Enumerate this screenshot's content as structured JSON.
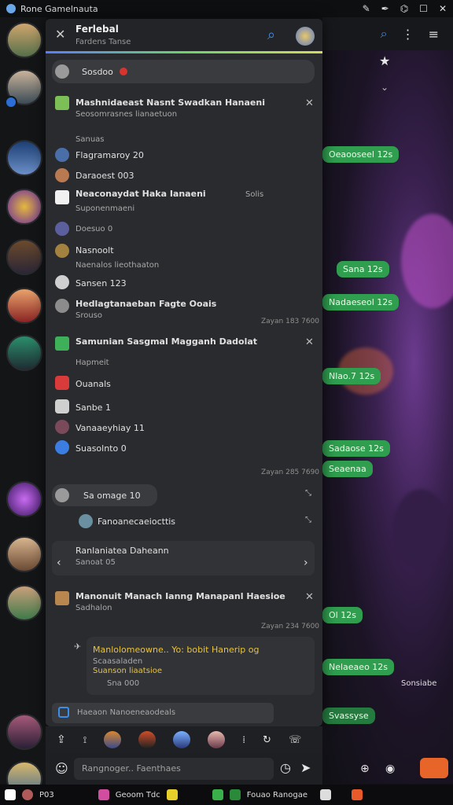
{
  "statusbar": {
    "title": "Rone Gamelnauta"
  },
  "panel": {
    "header": {
      "title": "Ferlebal",
      "subtitle": "Fardens Tanse"
    },
    "search": {
      "label": "Sosdoo"
    },
    "items": [
      {
        "title": "Mashnidaeast Nasnt Swadkan Hanaeni",
        "sub": "Seosomrasnes lianaetuon"
      },
      {
        "label": "Sanuas"
      },
      {
        "label": "Flagramaroy 20"
      },
      {
        "label": "Daraoest 003"
      },
      {
        "title": "Neaconaydat Haka Ianaeni",
        "extra": "Solis",
        "sub": "Suponenmaeni"
      },
      {
        "label": "Doesuo 0"
      },
      {
        "label": "Nasnoolt"
      },
      {
        "sub": "Naenalos lieothaaton"
      },
      {
        "label": "Sansen 123"
      },
      {
        "title": "Hedlagtanaeban Fagte Ooais",
        "sub": "Srouso"
      },
      {
        "time": "Zayan 183 7600"
      },
      {
        "title": "Samunian Sasgmal Magganh Dadolat",
        "sub": "Hapmeit"
      },
      {
        "label": "Ouanals"
      },
      {
        "label": "Sanbe 1"
      },
      {
        "label": "Vanaaeyhiay 11"
      },
      {
        "label": "Suasolnto 0"
      },
      {
        "time": "Zayan 285 7690"
      },
      {
        "label": "Sa omage 10"
      },
      {
        "label": "Fanoanecaeiocttis"
      },
      {
        "title": "Ranlaniatea Daheann",
        "sub": "Sanoat 05"
      },
      {
        "title": "Manonuit Manach Ianng Manapanl Haesioe",
        "sub": "Sadhalon"
      },
      {
        "time": "Zayan 234 7600"
      },
      {
        "title": "Manlolomeowne.. Yo: bobit Hanerip og",
        "sub": "Scaasaladen",
        "sub2": "Suanson liaatsioe",
        "foot": "Sna 000"
      }
    ],
    "input_placeholder": "Haeaon  Nanoeneaodeals"
  },
  "composer": {
    "placeholder": "Rangnoger.. Faenthaes"
  },
  "chat": {
    "bubbles": [
      "Oeaooseel 12s",
      "Sana 12s",
      "Nadaeseol 12s",
      "Nlao.7 12s",
      "Sadaose 12s",
      "Seaenaa",
      "Ol 12s",
      "Nelaeaeo 12s",
      "Svassyse"
    ],
    "top_right_label": "Sonsiabe"
  },
  "bottombar": {
    "items": [
      "P03",
      "Geoom Tdc",
      "Fouao Ranogae"
    ]
  },
  "colors": {
    "accent": "#2f9e4f",
    "panel": "#2a2b2e",
    "header_line": "#5b7cfa"
  }
}
